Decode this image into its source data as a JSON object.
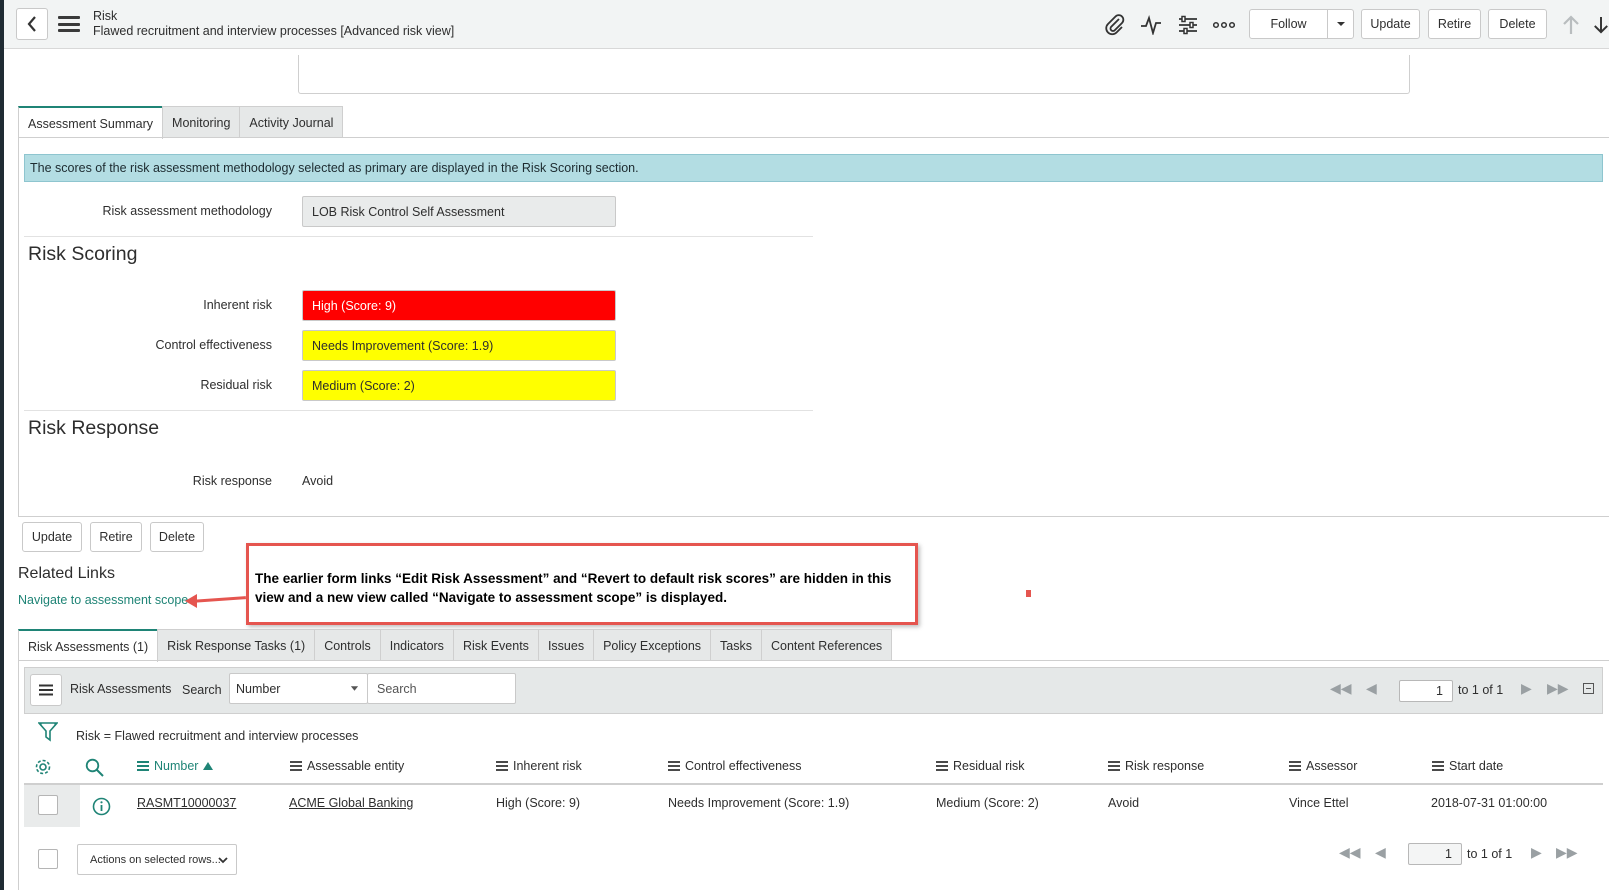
{
  "header": {
    "title": "Risk",
    "subtitle": "Flawed recruitment and interview processes [Advanced risk view]",
    "follow_label": "Follow",
    "update_label": "Update",
    "retire_label": "Retire",
    "delete_label": "Delete"
  },
  "form_tabs": [
    {
      "label": "Assessment Summary"
    },
    {
      "label": "Monitoring"
    },
    {
      "label": "Activity Journal"
    }
  ],
  "info_message": "The scores of the risk assessment methodology selected as primary are displayed in the Risk Scoring section.",
  "methodology": {
    "label": "Risk assessment methodology",
    "value": "LOB Risk Control Self Assessment"
  },
  "risk_scoring": {
    "title": "Risk Scoring",
    "inherent": {
      "label": "Inherent risk",
      "value": "High (Score: 9)",
      "color": "#ff0000"
    },
    "control": {
      "label": "Control effectiveness",
      "value": "Needs Improvement (Score: 1.9)",
      "color": "#ffff00"
    },
    "residual": {
      "label": "Residual risk",
      "value": "Medium (Score: 2)",
      "color": "#ffff00"
    }
  },
  "risk_response": {
    "title": "Risk Response",
    "label": "Risk response",
    "value": "Avoid"
  },
  "bottom_buttons": {
    "update": "Update",
    "retire": "Retire",
    "delete": "Delete"
  },
  "related_links": {
    "title": "Related Links",
    "link": "Navigate to assessment scope"
  },
  "callout": {
    "text": "The earlier form links “Edit Risk Assessment” and “Revert to default risk scores” are hidden in this view and a new view called “Navigate to assessment scope” is displayed."
  },
  "related_tabs": [
    {
      "label": "Risk Assessments (1)"
    },
    {
      "label": "Risk Response Tasks (1)"
    },
    {
      "label": "Controls"
    },
    {
      "label": "Indicators"
    },
    {
      "label": "Risk Events"
    },
    {
      "label": "Issues"
    },
    {
      "label": "Policy Exceptions"
    },
    {
      "label": "Tasks"
    },
    {
      "label": "Content References"
    }
  ],
  "list": {
    "title": "Risk Assessments",
    "search_label": "Search",
    "search_field": "Number",
    "search_placeholder": "Search",
    "page": "1",
    "page_of": "to 1 of 1",
    "filter": "Risk = Flawed recruitment and interview processes",
    "columns": [
      "Number",
      "Assessable entity",
      "Inherent risk",
      "Control effectiveness",
      "Residual risk",
      "Risk response",
      "Assessor",
      "Start date"
    ],
    "rows": [
      {
        "number": "RASMT10000037",
        "entity": "ACME Global Banking",
        "inherent": "High (Score: 9)",
        "control": "Needs Improvement (Score: 1.9)",
        "residual": "Medium (Score: 2)",
        "response": "Avoid",
        "assessor": "Vince Ettel",
        "start": "2018-07-31 01:00:00"
      }
    ],
    "actions_select": "Actions on selected rows...",
    "footer_page": "1",
    "footer_page_of": "to 1 of 1"
  }
}
